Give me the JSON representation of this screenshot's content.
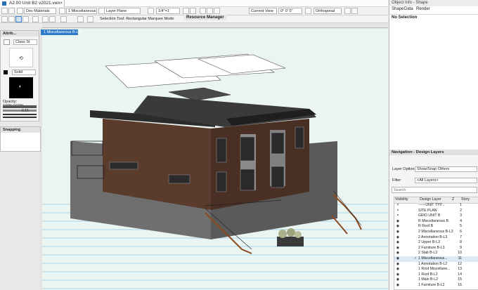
{
  "window": {
    "doc_tab": "A2.00 Unit B2 v2021.vwx",
    "tab_close": "×"
  },
  "toolbar": {
    "class_dd": "Dev Materials",
    "layer_dd": "1 Miscellaneous B-L2",
    "plane_dd": "Layer Plane",
    "scale_dd": "1/4\"=1'",
    "view_dd": "Current View",
    "rotation_dd": "0° 0' 0\"",
    "projection_dd": "Orthogonal"
  },
  "toolbar2": {
    "mode_label": "Selection Tool: Rectangular Marquee Mode",
    "resource_manager": "Resource Manager"
  },
  "layer_tab": "1 Miscellaneous B-L2",
  "attributes": {
    "title": "Attrib...",
    "class_style": "Class St",
    "pen_style": "Solid",
    "opacity": "Opacity: 100%/100%",
    "lineweight": "0.15"
  },
  "snapping": {
    "title": "Snapping"
  },
  "object_info": {
    "title": "Object Info - Shape",
    "tabs": [
      "Shape",
      "Data",
      "Render"
    ],
    "selection": "No Selection"
  },
  "navigation": {
    "title": "Navigation - Design Layers",
    "layer_options_label": "Layer Options",
    "layer_options_value": "Show/Snap Others",
    "filter_label": "Filter",
    "filter_value": "<All Layers>",
    "search_placeholder": "Search",
    "columns": [
      "Visibility",
      "Design Layer",
      "Z",
      "Story"
    ],
    "rows": [
      {
        "name": "------UNIT TYP...",
        "num": "1",
        "visible": "×",
        "active": ""
      },
      {
        "name": "SITE PLAN",
        "num": "2",
        "visible": "×",
        "active": ""
      },
      {
        "name": "GRID UNIT B",
        "num": "3",
        "visible": "×",
        "active": ""
      },
      {
        "name": "R Miscellaneous B",
        "num": "4",
        "visible": "◉",
        "active": ""
      },
      {
        "name": "R Roof B",
        "num": "5",
        "visible": "◉",
        "active": ""
      },
      {
        "name": "2 Miscellaneous B-L3",
        "num": "6",
        "visible": "◉",
        "active": ""
      },
      {
        "name": "2 Annotation B-L3",
        "num": "7",
        "visible": "◉",
        "active": ""
      },
      {
        "name": "2 Upper B-L3",
        "num": "8",
        "visible": "◉",
        "active": ""
      },
      {
        "name": "2 Furniture B-L3",
        "num": "9",
        "visible": "◉",
        "active": ""
      },
      {
        "name": "2 Slab B-L3",
        "num": "10",
        "visible": "◉",
        "active": ""
      },
      {
        "name": "1 Miscellaneous...",
        "num": "11",
        "visible": "◉",
        "active": "✓"
      },
      {
        "name": "1 Annotation B-L2",
        "num": "12",
        "visible": "◉",
        "active": ""
      },
      {
        "name": "1 Roof Miscellane...",
        "num": "13",
        "visible": "◉",
        "active": ""
      },
      {
        "name": "1 Roof B-L2",
        "num": "14",
        "visible": "◉",
        "active": ""
      },
      {
        "name": "1 Main B-L2",
        "num": "15",
        "visible": "◉",
        "active": ""
      },
      {
        "name": "1 Furniture B-L2",
        "num": "16",
        "visible": "◉",
        "active": ""
      }
    ]
  },
  "colors": {
    "accent": "#2f7ac9",
    "canvas": "#eaf5f2",
    "grid": "#2b8fd6"
  }
}
